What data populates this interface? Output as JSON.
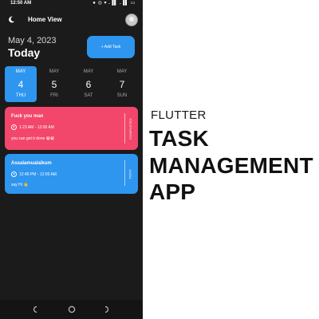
{
  "status_bar": {
    "time": "12:50 AM",
    "icons": "● ◎ ▾ .▐▌ .▐▌ ▭"
  },
  "app_bar": {
    "title": "Home View"
  },
  "header": {
    "date": "May 4, 2023",
    "today": "Today",
    "add_task_label": "+ Add Task"
  },
  "date_strip": [
    {
      "month": "MAY",
      "day": "4",
      "weekday": "THU",
      "selected": true
    },
    {
      "month": "MAY",
      "day": "5",
      "weekday": "FRI",
      "selected": false
    },
    {
      "month": "MAY",
      "day": "6",
      "weekday": "SAT",
      "selected": false
    },
    {
      "month": "MAY",
      "day": "7",
      "weekday": "SUN",
      "selected": false
    }
  ],
  "tasks": [
    {
      "title": "Fuck you man",
      "time": "1:23 AM - 12:00 AM",
      "note": "you can get it done 😁😁",
      "status": "COMPLETED",
      "color": "#f2466b"
    },
    {
      "title": "Assalamualaikum",
      "time": "12:45 PM - 12:00 AM",
      "note": "say Hi 👋",
      "status": "TODO",
      "color": "#2e96ef"
    }
  ],
  "promo": {
    "subtitle": "FLUTTER",
    "line1": "TASK",
    "line2": "MANAGEMENT",
    "line3": "APP"
  },
  "colors": {
    "accent": "#2e96ef",
    "completed": "#f2466b",
    "background": "#1b1b1b"
  },
  "icons": {
    "theme_toggle": "moon-icon",
    "profile": "avatar",
    "clock": "clock-icon",
    "nav": [
      "back-icon",
      "home-icon",
      "recent-apps-icon"
    ]
  }
}
